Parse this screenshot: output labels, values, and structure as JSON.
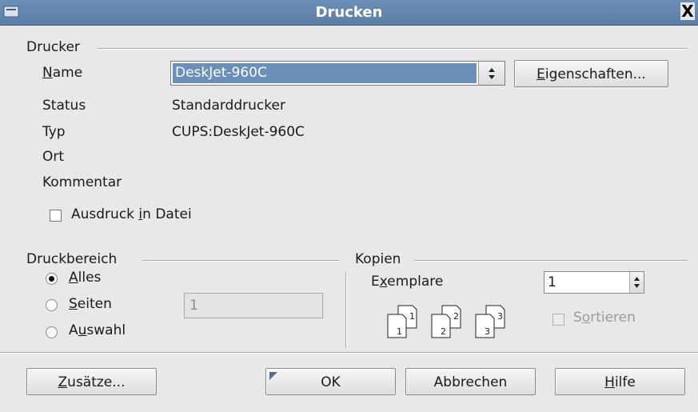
{
  "window": {
    "title": "Drucken",
    "close_label": "X"
  },
  "printer_group": {
    "title": "Drucker",
    "name_label": "Name",
    "name_value": "DeskJet-960C",
    "properties_button": "Eigenschaften...",
    "status_label": "Status",
    "status_value": "Standarddrucker",
    "type_label": "Typ",
    "type_value": "CUPS:DeskJet-960C",
    "location_label": "Ort",
    "comment_label": "Kommentar",
    "print_to_file_label": "Ausdruck in Datei",
    "print_to_file_checked": false
  },
  "range_group": {
    "title": "Druckbereich",
    "options": [
      {
        "label": "Alles",
        "selected": true
      },
      {
        "label": "Seiten",
        "selected": false
      },
      {
        "label": "Auswahl",
        "selected": false
      }
    ],
    "pages_value": "1"
  },
  "copies_group": {
    "title": "Kopien",
    "copies_label": "Exemplare",
    "copies_value": "1",
    "collate_label": "Sortieren",
    "collate_checked": false,
    "collate_enabled": false,
    "page_numbers": [
      "1",
      "2",
      "3"
    ]
  },
  "buttons": {
    "extras": "Zusätze...",
    "ok": "OK",
    "cancel": "Abbrechen",
    "help": "Hilfe"
  }
}
